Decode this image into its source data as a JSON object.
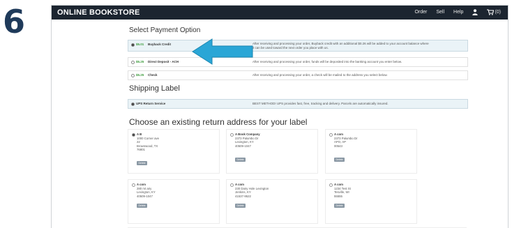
{
  "step_number": "6",
  "brand": "ONLINE BOOKSTORE",
  "nav": {
    "order": "Order",
    "sell": "Sell",
    "help": "Help",
    "cart_count": "(0)",
    "user_icon": "user-icon",
    "cart_icon": "cart-icon"
  },
  "payment": {
    "heading": "Select Payment Option",
    "options": [
      {
        "amount": "$5.01",
        "name": "Buyback Credit",
        "desc": "After receiving and processing your order, Buyback credit with an additional $0.26 will be added to your account balance where",
        "desc2": "it can be used toward the next order you place with us.",
        "selected": true
      },
      {
        "amount": "$5.25",
        "name": "Direct Deposit - ACH",
        "desc": "After receiving and processing your order, funds will be deposited into the banking account you enter below.",
        "desc2": "",
        "selected": false
      },
      {
        "amount": "$5.25",
        "name": "Check",
        "desc": "After receiving and processing your order, a check will be mailed to the address you select below.",
        "desc2": "",
        "selected": false
      }
    ]
  },
  "shipping": {
    "heading": "Shipping Label",
    "option": {
      "name": "UPS Return Service",
      "desc": "BEST METHOD! UPS provides fast, free, tracking and delivery. Parcels are automatically insured.",
      "selected": true
    }
  },
  "addresses": {
    "heading": "Choose an existing return address for your label",
    "delete_label": "Delete",
    "cards": [
      {
        "lines": [
          "A B",
          "1000 Corner ave",
          "22",
          "Brownwood, TX",
          "76801"
        ],
        "selected": true
      },
      {
        "lines": [
          "A Book Company",
          "2373 Palumbo Dr",
          "Lexington, KY",
          "40509-1047"
        ],
        "selected": false
      },
      {
        "lines": [
          "A com",
          "2373 Palumbo Dr",
          "APO, AP",
          "00543"
        ],
        "selected": false
      },
      {
        "lines": [
          "A com",
          "280 mt airy",
          "Lexington, KY",
          "40509-1047"
        ],
        "selected": false
      },
      {
        "lines": [
          "A com",
          "230 Dairy Hole Lexington",
          "Jenkins, KY",
          "41537-9522"
        ],
        "selected": false
      },
      {
        "lines": [
          "A com",
          "1234 Test St",
          "Tesville, WI",
          "55555"
        ],
        "selected": false
      }
    ]
  },
  "colors": {
    "topbar": "#1c2530",
    "arrow": "#2aa6d6",
    "step": "#1f3a5a",
    "amount": "#3a9a3a"
  }
}
